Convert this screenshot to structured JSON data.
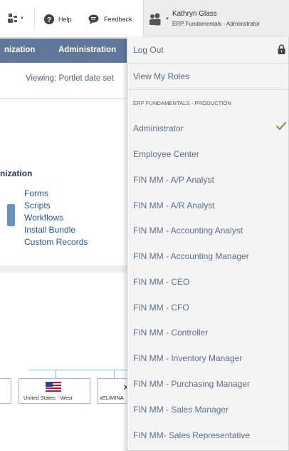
{
  "topbar": {
    "help_label": "Help",
    "feedback_label": "Feedback"
  },
  "user": {
    "name": "Kathryn Glass",
    "role": "ERP Fundamentals - Administrator"
  },
  "nav": {
    "items": [
      "nization",
      "Administration"
    ]
  },
  "page": {
    "viewing": "Viewing: Portlet date set",
    "section_title": "nization",
    "links": [
      "Forms",
      "Scripts",
      "Workflows",
      "Install Bundle",
      "Custom Records"
    ],
    "org_nodes": [
      {
        "label": "United States - West"
      },
      {
        "label": "xELIMINA"
      }
    ],
    "node_fragment": "X"
  },
  "menu": {
    "logout": "Log Out",
    "view_roles": "View My Roles",
    "section_header": "ERP FUNDAMENTALS - PRODUCTION",
    "roles": [
      "Administrator",
      "Employee Center",
      "FIN MM - A/P Analyst",
      "FIN MM - A/R Analyst",
      "FIN MM - Accounting Analyst",
      "FIN MM - Accounting Manager",
      "FIN MM - CEO",
      "FIN MM - CFO",
      "FIN MM - Controller",
      "FIN MM - Inventory Manager",
      "FIN MM - Purchasing Manager",
      "FIN MM - Sales Manager",
      "FIN MM- Sales Representative"
    ],
    "active_role": "Administrator",
    "check_color": "#6aa84f"
  },
  "colors": {
    "navbar": "#607799",
    "link": "#255599",
    "menu_text": "#5e6f88"
  }
}
